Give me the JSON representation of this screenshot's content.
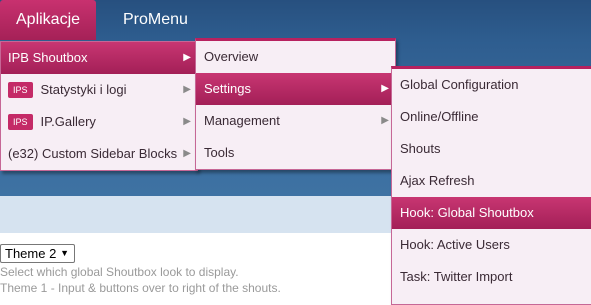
{
  "topnav": {
    "items": [
      "Aplikacje",
      "ProMenu"
    ]
  },
  "menu1": {
    "items": [
      {
        "label": "IPB Shoutbox",
        "badge": ""
      },
      {
        "label": "Statystyki i logi",
        "badge": "IPS"
      },
      {
        "label": "IP.Gallery",
        "badge": "IPS"
      },
      {
        "label": "(e32) Custom Sidebar Blocks",
        "badge": ""
      }
    ]
  },
  "menu2": {
    "items": [
      "Overview",
      "Settings",
      "Management",
      "Tools"
    ]
  },
  "menu3": {
    "items": [
      "Global Configuration",
      "Online/Offline",
      "Shouts",
      "Ajax Refresh",
      "Hook: Global Shoutbox",
      "Hook: Active Users",
      "Task: Twitter Import"
    ]
  },
  "content": {
    "theme_value": "Theme 2",
    "help_line1": "Select which global Shoutbox look to display.",
    "help_line2": "Theme 1 - Input & buttons over to right of the shouts."
  },
  "icons": {
    "submenu_arrow": "caret-right-icon",
    "select_arrow": "caret-down-icon"
  },
  "colors": {
    "accent": "#b7215f",
    "nav_bg": "#2e5d8f",
    "menu_bg": "#f7eef5"
  }
}
